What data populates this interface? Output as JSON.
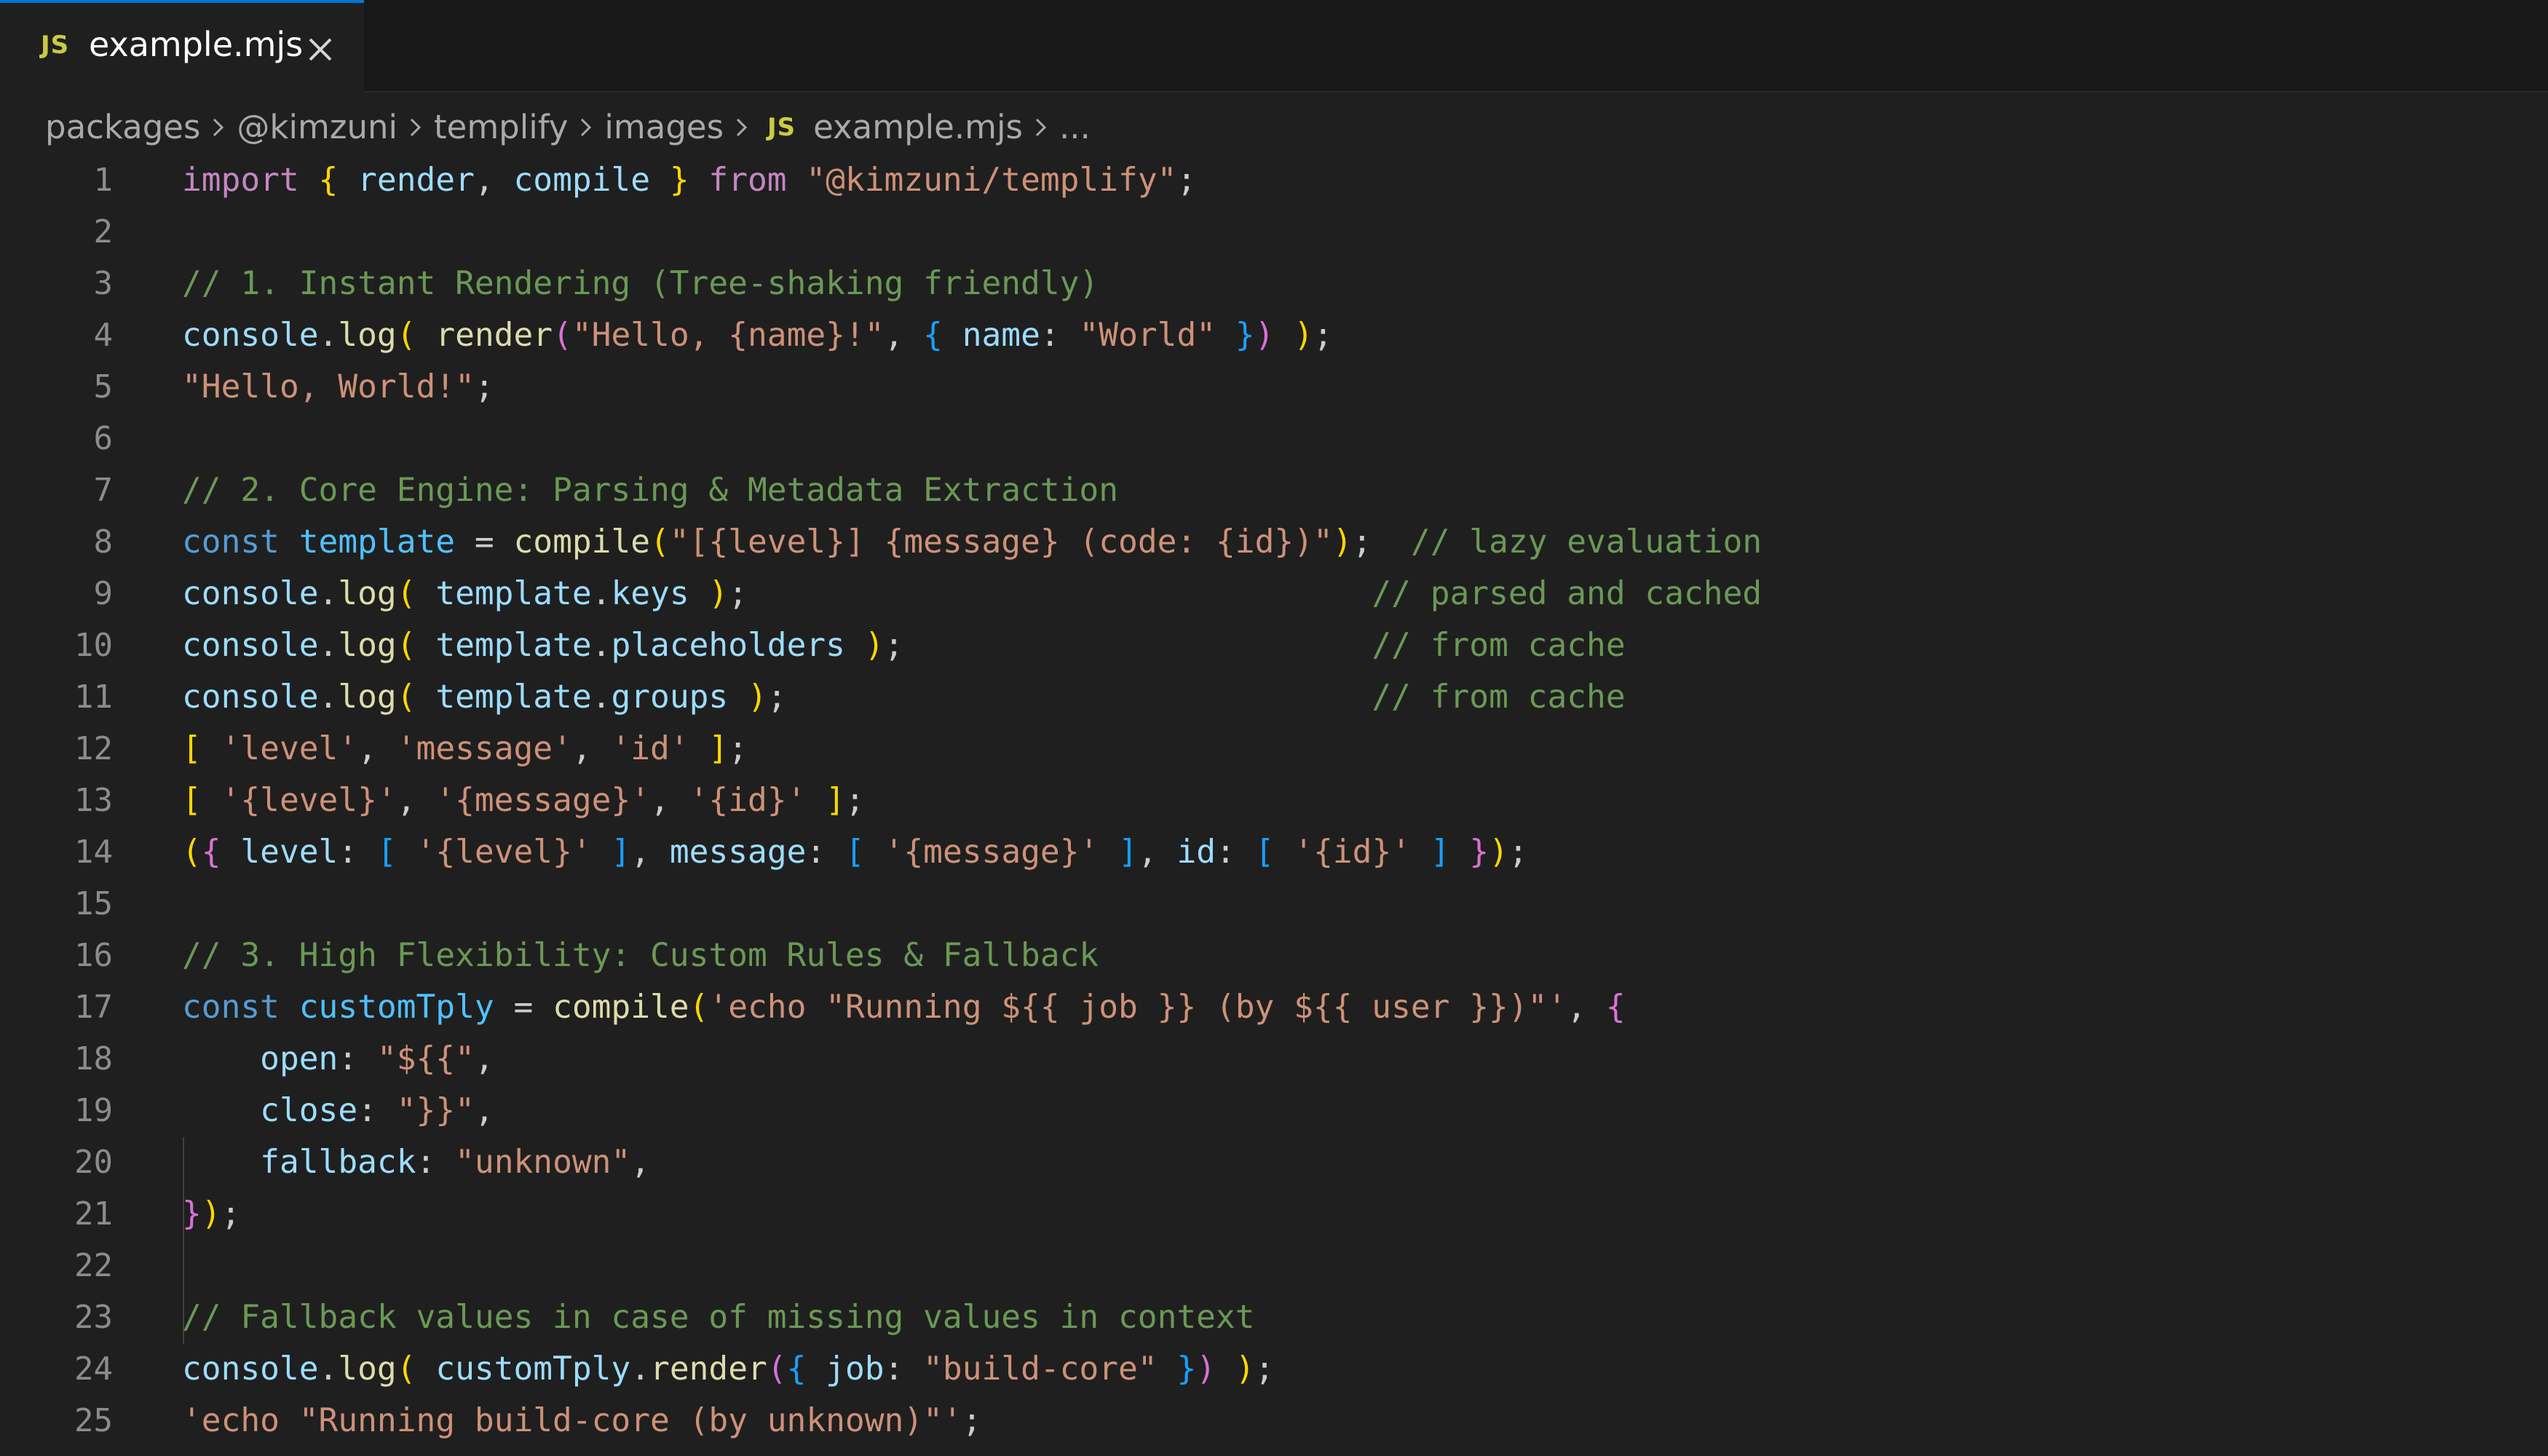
{
  "tab": {
    "lang_badge": "JS",
    "title": "example.mjs"
  },
  "breadcrumb": {
    "items": [
      "packages",
      "@kimzuni",
      "templify",
      "images",
      "example.mjs",
      "..."
    ],
    "file_badge": "JS"
  },
  "editor": {
    "line_numbers": [
      "1",
      "2",
      "3",
      "4",
      "5",
      "6",
      "7",
      "8",
      "9",
      "10",
      "11",
      "12",
      "13",
      "14",
      "15",
      "16",
      "17",
      "18",
      "19",
      "20",
      "21",
      "22",
      "23",
      "24",
      "25"
    ],
    "lines": [
      [
        [
          "k",
          "import"
        ],
        [
          "t",
          " "
        ],
        [
          "p1",
          "{"
        ],
        [
          "t",
          " "
        ],
        [
          "v",
          "render"
        ],
        [
          "t",
          ", "
        ],
        [
          "v",
          "compile"
        ],
        [
          "t",
          " "
        ],
        [
          "p1",
          "}"
        ],
        [
          "t",
          " "
        ],
        [
          "k",
          "from"
        ],
        [
          "t",
          " "
        ],
        [
          "s",
          "\"@kimzuni/templify\""
        ],
        [
          "t",
          ";"
        ]
      ],
      [],
      [
        [
          "c",
          "// 1. Instant Rendering (Tree-shaking friendly)"
        ]
      ],
      [
        [
          "v",
          "console"
        ],
        [
          "t",
          "."
        ],
        [
          "f",
          "log"
        ],
        [
          "p1",
          "("
        ],
        [
          "t",
          " "
        ],
        [
          "f",
          "render"
        ],
        [
          "p2",
          "("
        ],
        [
          "s",
          "\"Hello, {name}!\""
        ],
        [
          "t",
          ", "
        ],
        [
          "p3",
          "{"
        ],
        [
          "t",
          " "
        ],
        [
          "v",
          "name"
        ],
        [
          "t",
          ": "
        ],
        [
          "s",
          "\"World\""
        ],
        [
          "t",
          " "
        ],
        [
          "p3",
          "}"
        ],
        [
          "p2",
          ")"
        ],
        [
          "t",
          " "
        ],
        [
          "p1",
          ")"
        ],
        [
          "t",
          ";"
        ]
      ],
      [
        [
          "s",
          "\"Hello, World!\""
        ],
        [
          "t",
          ";"
        ]
      ],
      [],
      [
        [
          "c",
          "// 2. Core Engine: Parsing & Metadata Extraction"
        ]
      ],
      [
        [
          "b",
          "const"
        ],
        [
          "t",
          " "
        ],
        [
          "cv",
          "template"
        ],
        [
          "t",
          " = "
        ],
        [
          "f",
          "compile"
        ],
        [
          "p1",
          "("
        ],
        [
          "s",
          "\"[{level}] {message} (code: {id})\""
        ],
        [
          "p1",
          ")"
        ],
        [
          "t",
          ";  "
        ],
        [
          "c",
          "// lazy evaluation"
        ]
      ],
      [
        [
          "v",
          "console"
        ],
        [
          "t",
          "."
        ],
        [
          "f",
          "log"
        ],
        [
          "p1",
          "("
        ],
        [
          "t",
          " "
        ],
        [
          "v",
          "template"
        ],
        [
          "t",
          "."
        ],
        [
          "v",
          "keys"
        ],
        [
          "t",
          " "
        ],
        [
          "p1",
          ")"
        ],
        [
          "t",
          ";                                "
        ],
        [
          "c",
          "// parsed and cached"
        ]
      ],
      [
        [
          "v",
          "console"
        ],
        [
          "t",
          "."
        ],
        [
          "f",
          "log"
        ],
        [
          "p1",
          "("
        ],
        [
          "t",
          " "
        ],
        [
          "v",
          "template"
        ],
        [
          "t",
          "."
        ],
        [
          "v",
          "placeholders"
        ],
        [
          "t",
          " "
        ],
        [
          "p1",
          ")"
        ],
        [
          "t",
          ";                        "
        ],
        [
          "c",
          "// from cache"
        ]
      ],
      [
        [
          "v",
          "console"
        ],
        [
          "t",
          "."
        ],
        [
          "f",
          "log"
        ],
        [
          "p1",
          "("
        ],
        [
          "t",
          " "
        ],
        [
          "v",
          "template"
        ],
        [
          "t",
          "."
        ],
        [
          "v",
          "groups"
        ],
        [
          "t",
          " "
        ],
        [
          "p1",
          ")"
        ],
        [
          "t",
          ";                              "
        ],
        [
          "c",
          "// from cache"
        ]
      ],
      [
        [
          "p1",
          "["
        ],
        [
          "t",
          " "
        ],
        [
          "s",
          "'level'"
        ],
        [
          "t",
          ", "
        ],
        [
          "s",
          "'message'"
        ],
        [
          "t",
          ", "
        ],
        [
          "s",
          "'id'"
        ],
        [
          "t",
          " "
        ],
        [
          "p1",
          "]"
        ],
        [
          "t",
          ";"
        ]
      ],
      [
        [
          "p1",
          "["
        ],
        [
          "t",
          " "
        ],
        [
          "s",
          "'{level}'"
        ],
        [
          "t",
          ", "
        ],
        [
          "s",
          "'{message}'"
        ],
        [
          "t",
          ", "
        ],
        [
          "s",
          "'{id}'"
        ],
        [
          "t",
          " "
        ],
        [
          "p1",
          "]"
        ],
        [
          "t",
          ";"
        ]
      ],
      [
        [
          "p1",
          "("
        ],
        [
          "p2",
          "{"
        ],
        [
          "t",
          " "
        ],
        [
          "v",
          "level"
        ],
        [
          "t",
          ": "
        ],
        [
          "p3",
          "["
        ],
        [
          "t",
          " "
        ],
        [
          "s",
          "'{level}'"
        ],
        [
          "t",
          " "
        ],
        [
          "p3",
          "]"
        ],
        [
          "t",
          ", "
        ],
        [
          "v",
          "message"
        ],
        [
          "t",
          ": "
        ],
        [
          "p3",
          "["
        ],
        [
          "t",
          " "
        ],
        [
          "s",
          "'{message}'"
        ],
        [
          "t",
          " "
        ],
        [
          "p3",
          "]"
        ],
        [
          "t",
          ", "
        ],
        [
          "v",
          "id"
        ],
        [
          "t",
          ": "
        ],
        [
          "p3",
          "["
        ],
        [
          "t",
          " "
        ],
        [
          "s",
          "'{id}'"
        ],
        [
          "t",
          " "
        ],
        [
          "p3",
          "]"
        ],
        [
          "t",
          " "
        ],
        [
          "p2",
          "}"
        ],
        [
          "p1",
          ")"
        ],
        [
          "t",
          ";"
        ]
      ],
      [],
      [
        [
          "c",
          "// 3. High Flexibility: Custom Rules & Fallback"
        ]
      ],
      [
        [
          "b",
          "const"
        ],
        [
          "t",
          " "
        ],
        [
          "cv",
          "customTply"
        ],
        [
          "t",
          " = "
        ],
        [
          "f",
          "compile"
        ],
        [
          "p1",
          "("
        ],
        [
          "s",
          "'echo \"Running ${{ job }} (by ${{ user }})\"'"
        ],
        [
          "t",
          ", "
        ],
        [
          "p2",
          "{"
        ]
      ],
      [
        [
          "t",
          "    "
        ],
        [
          "v",
          "open"
        ],
        [
          "t",
          ": "
        ],
        [
          "s",
          "\"${{\""
        ],
        [
          "t",
          ","
        ]
      ],
      [
        [
          "t",
          "    "
        ],
        [
          "v",
          "close"
        ],
        [
          "t",
          ": "
        ],
        [
          "s",
          "\"}}\""
        ],
        [
          "t",
          ","
        ]
      ],
      [
        [
          "t",
          "    "
        ],
        [
          "v",
          "fallback"
        ],
        [
          "t",
          ": "
        ],
        [
          "s",
          "\"unknown\""
        ],
        [
          "t",
          ","
        ]
      ],
      [
        [
          "p2",
          "}"
        ],
        [
          "p1",
          ")"
        ],
        [
          "t",
          ";"
        ]
      ],
      [],
      [
        [
          "c",
          "// Fallback values in case of missing values in context"
        ]
      ],
      [
        [
          "v",
          "console"
        ],
        [
          "t",
          "."
        ],
        [
          "f",
          "log"
        ],
        [
          "p1",
          "("
        ],
        [
          "t",
          " "
        ],
        [
          "v",
          "customTply"
        ],
        [
          "t",
          "."
        ],
        [
          "f",
          "render"
        ],
        [
          "p2",
          "("
        ],
        [
          "p3",
          "{"
        ],
        [
          "t",
          " "
        ],
        [
          "v",
          "job"
        ],
        [
          "t",
          ": "
        ],
        [
          "s",
          "\"build-core\""
        ],
        [
          "t",
          " "
        ],
        [
          "p3",
          "}"
        ],
        [
          "p2",
          ")"
        ],
        [
          "t",
          " "
        ],
        [
          "p1",
          ")"
        ],
        [
          "t",
          ";"
        ]
      ],
      [
        [
          "s",
          "'echo \"Running build-core (by unknown)\"'"
        ],
        [
          "t",
          ";"
        ]
      ]
    ]
  }
}
